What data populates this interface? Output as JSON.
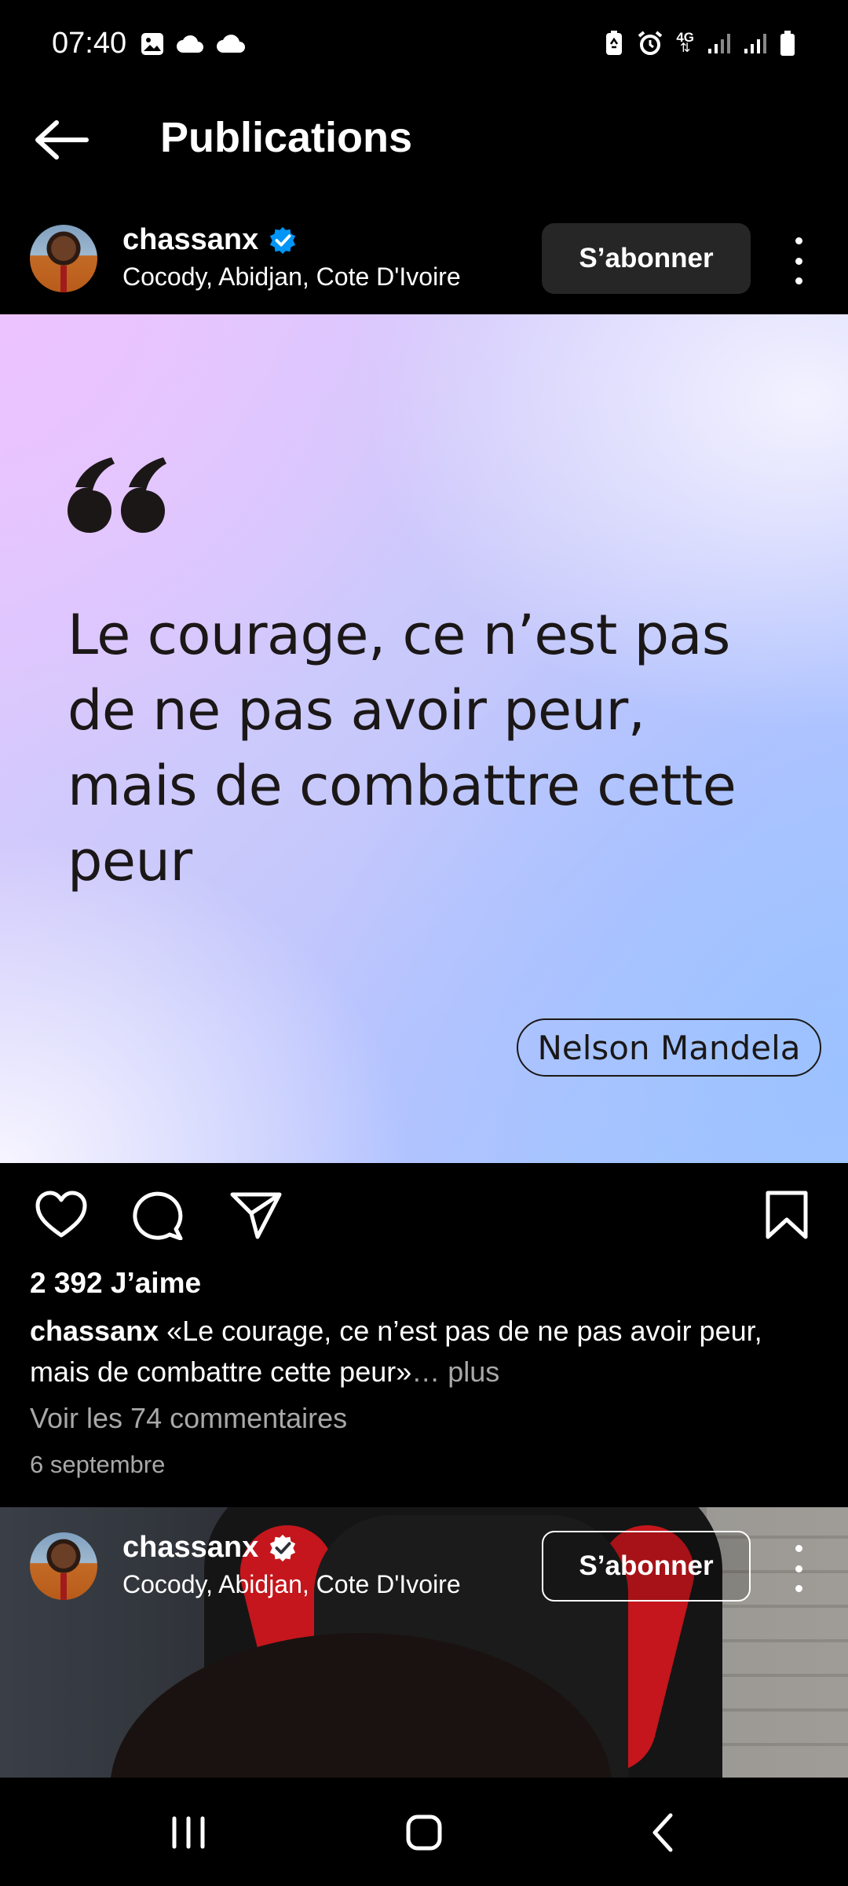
{
  "status_bar": {
    "time": "07:40",
    "left_icons": [
      "gallery-icon",
      "cloud-icon",
      "cloud-icon"
    ],
    "right_icons": [
      "battery-saver-icon",
      "alarm-icon",
      "network-4g-icon",
      "signal-icon",
      "signal-icon",
      "battery-icon"
    ],
    "network_label": "4G"
  },
  "app_bar": {
    "title": "Publications",
    "back_icon": "arrow-left-icon"
  },
  "post": {
    "username": "chassanx",
    "verified": true,
    "location": "Cocody, Abidjan, Cote D'Ivoire",
    "follow_label": "S’abonner",
    "image": {
      "quote": "Le courage, ce n’est pas de ne pas avoir peur, mais de combattre cette peur",
      "author": "Nelson Mandela"
    },
    "likes": "2 392 J’aime",
    "caption_user": "chassanx",
    "caption_text": " «Le courage, ce n’est pas de ne pas avoir peur, mais de combattre cette peur»",
    "caption_more": "… plus",
    "comments_link": "Voir les 74 commentaires",
    "date": "6 septembre"
  },
  "post2": {
    "username": "chassanx",
    "verified": true,
    "location": "Cocody, Abidjan, Cote D'Ivoire",
    "follow_label": "S’abonner"
  },
  "colors": {
    "background": "#000000",
    "verified_badge": "#0095f6",
    "button_bg": "#262626",
    "secondary_text": "#a8a8a8",
    "quote_text": "#1b1717"
  }
}
